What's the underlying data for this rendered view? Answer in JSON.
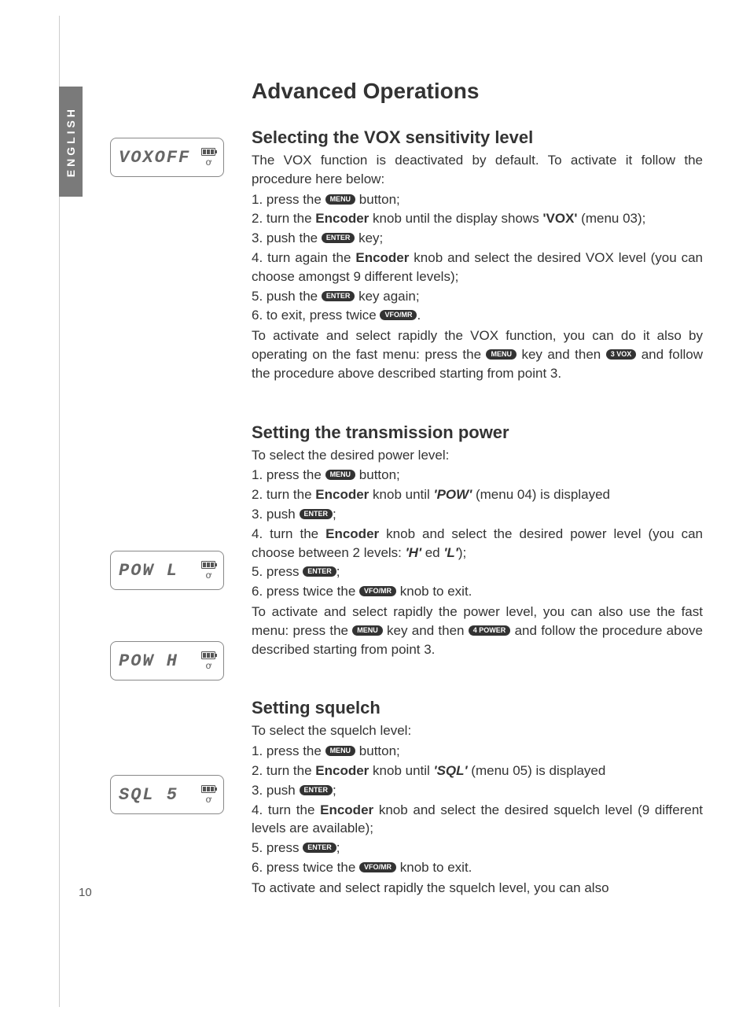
{
  "sidebar": {
    "lang": "ENGLISH"
  },
  "page": {
    "number": "10"
  },
  "title": "Advanced Operations",
  "lcd": {
    "vox": "VOXOFF",
    "pow_l": "POW   L",
    "pow_h": "POW   H",
    "sql": "SQL   5"
  },
  "keys": {
    "menu": "MENU",
    "enter": "ENTER",
    "vfomr": "VFO/MR",
    "vox3": "3 VOX",
    "power4": "4 POWER"
  },
  "section1": {
    "title": "Selecting the VOX sensitivity level",
    "intro": "The VOX function is deactivated by default. To activate it follow the procedure here below:",
    "s1a": "1. press the ",
    "s1b": " button;",
    "s2a": "2. turn the ",
    "s2b": "Encoder",
    "s2c": " knob until the display shows ",
    "s2d": "'VOX'",
    "s2e": " (menu 03);",
    "s3a": "3. push the ",
    "s3b": " key;",
    "s4a": "4. turn again the ",
    "s4b": "Encoder",
    "s4c": " knob and select the desired VOX level (you can choose amongst 9 different levels);",
    "s5a": "5. push the ",
    "s5b": " key again;",
    "s6a": "6. to exit, press twice ",
    "s6b": ".",
    "outro1": "To activate and select rapidly the VOX function, you can do it also by operating on the fast menu: press the ",
    "outro2": " key and then ",
    "outro3": " and follow the procedure above described starting from point 3."
  },
  "section2": {
    "title": "Setting the transmission power",
    "intro": "To select the desired power level:",
    "s1a": "1. press the ",
    "s1b": " button;",
    "s2a": "2. turn the ",
    "s2b": "Encoder",
    "s2c": " knob until ",
    "s2d": "'POW'",
    "s2e": " (menu 04) is displayed",
    "s3a": "3. push ",
    "s3b": ";",
    "s4a": "4. turn the ",
    "s4b": "Encoder",
    "s4c": " knob and select the desired power level (you can choose between 2 levels: ",
    "s4d": "'H'",
    "s4e": " ed ",
    "s4f": "'L'",
    "s4g": ");",
    "s5a": "5. press ",
    "s5b": ";",
    "s6a": "6. press twice the ",
    "s6b": " knob to exit.",
    "outro1": "To activate and select rapidly the power level, you can also use the fast menu: press the ",
    "outro2": " key and then ",
    "outro3": " and follow the procedure above described starting from point 3."
  },
  "section3": {
    "title": "Setting squelch",
    "intro": "To select the squelch level:",
    "s1a": "1. press the ",
    "s1b": " button;",
    "s2a": "2. turn the ",
    "s2b": "Encoder",
    "s2c": " knob until ",
    "s2d": "'SQL'",
    "s2e": " (menu 05) is displayed",
    "s3a": "3. push ",
    "s3b": ";",
    "s4a": "4. turn the ",
    "s4b": "Encoder",
    "s4c": " knob and select the desired squelch level (9 different levels are available);",
    "s5a": "5. press ",
    "s5b": ";",
    "s6a": "6. press twice the ",
    "s6b": " knob to exit.",
    "outro": "To activate and select rapidly the squelch level, you can also"
  }
}
